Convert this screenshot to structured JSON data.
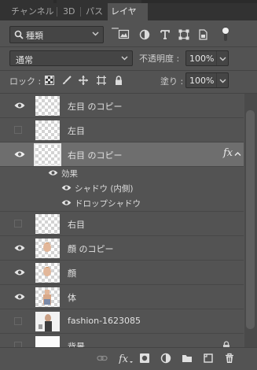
{
  "tabs": [
    {
      "label": "チャンネル",
      "active": false
    },
    {
      "label": "3D",
      "active": false
    },
    {
      "label": "パス",
      "active": false
    },
    {
      "label": "レイヤー",
      "active": true
    }
  ],
  "filter": {
    "kind_label": "種類",
    "icons": [
      "pixel-filter-icon",
      "adjustment-filter-icon",
      "type-filter-icon",
      "shape-filter-icon",
      "smart-object-filter-icon"
    ]
  },
  "blend": {
    "mode": "通常",
    "opacity_label": "不透明度 :",
    "opacity_value": "100%"
  },
  "lock": {
    "label": "ロック :",
    "fill_label": "塗り :",
    "fill_value": "100%"
  },
  "layers": [
    {
      "name": "左目 のコピー",
      "visible": true,
      "thumb": "checker"
    },
    {
      "name": "左目",
      "visible": false,
      "thumb": "checker"
    },
    {
      "name": "右目 のコピー",
      "visible": true,
      "thumb": "checker",
      "selected": true,
      "fx": "fx"
    },
    {
      "name": "右目",
      "visible": false,
      "thumb": "checker"
    },
    {
      "name": "顔 のコピー",
      "visible": true,
      "thumb": "face"
    },
    {
      "name": "顔",
      "visible": true,
      "thumb": "face"
    },
    {
      "name": "体",
      "visible": true,
      "thumb": "body"
    },
    {
      "name": "fashion-1623085",
      "visible": false,
      "thumb": "photo"
    },
    {
      "name": "背景",
      "visible": false,
      "thumb": "solid"
    }
  ],
  "effects": {
    "group_label": "効果",
    "items": [
      "シャドウ (内側)",
      "ドロップシャドウ"
    ]
  },
  "bottom_icons": [
    "link-layers-icon",
    "fx-icon",
    "layer-mask-icon",
    "adjustment-layer-icon",
    "new-group-icon",
    "new-layer-icon",
    "delete-layer-icon"
  ],
  "colors": {
    "panel": "#535353",
    "selected_row": "#6e6e6e",
    "tab_bar": "#323232"
  }
}
